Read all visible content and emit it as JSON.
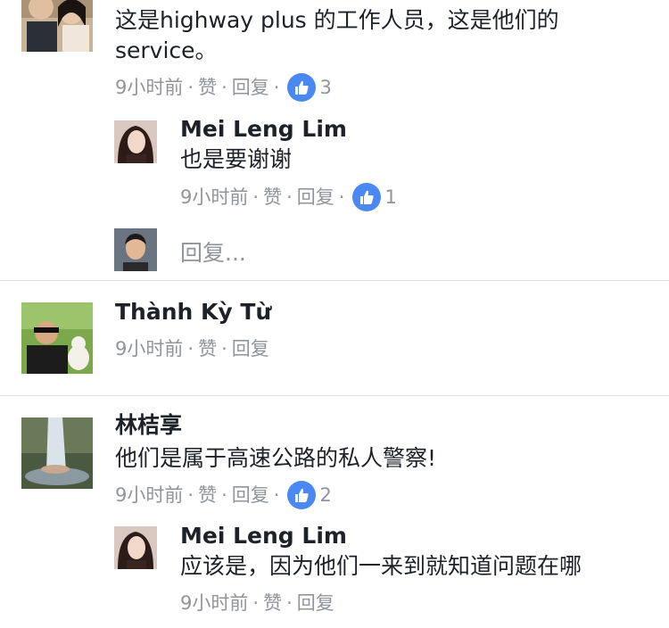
{
  "comment1": {
    "text_line1": "这是highway plus 的工作人员，这是他们的",
    "text_line2": "service。",
    "time": "9小时前",
    "like": "赞",
    "reply": "回复",
    "reactions": "3",
    "reply1": {
      "name": "Mei Leng Lim",
      "text": "也是要谢谢",
      "time": "9小时前",
      "like": "赞",
      "reply": "回复",
      "reactions": "1"
    },
    "reply_placeholder": "回复..."
  },
  "comment2": {
    "name": "Thành Kỳ Từ",
    "time": "9小时前",
    "like": "赞",
    "reply": "回复"
  },
  "comment3": {
    "name": "林桔享",
    "text": "他们是属于高速公路的私人警察!",
    "time": "9小时前",
    "like": "赞",
    "reply": "回复",
    "reactions": "2",
    "reply1": {
      "name": "Mei Leng Lim",
      "text": "应该是，因为他们一来到就知道问题在哪",
      "time": "9小时前",
      "like": "赞",
      "reply": "回复"
    }
  },
  "colors": {
    "like_badge": "#4a89f3",
    "meta_text": "#90949c",
    "divider": "#dddfe2"
  },
  "icons": [
    "thumbs-up-icon"
  ]
}
